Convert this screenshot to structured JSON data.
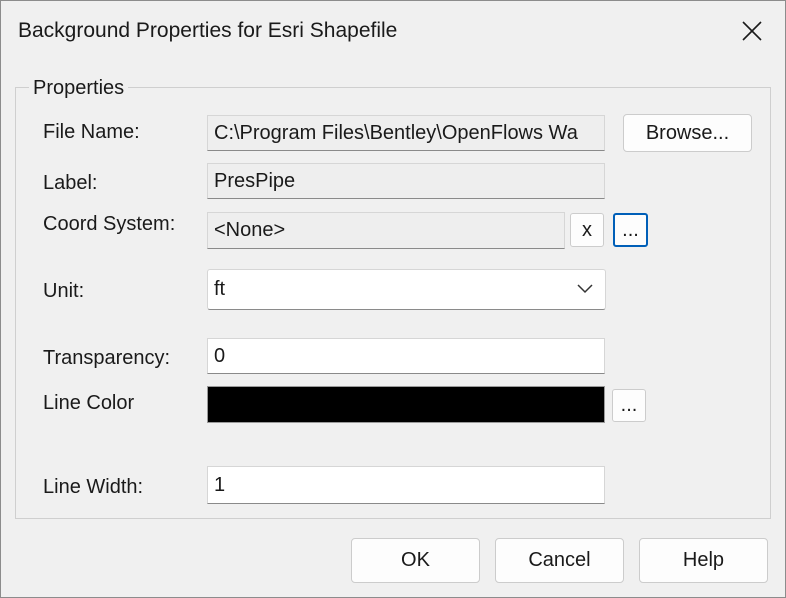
{
  "window": {
    "title": "Background Properties for Esri Shapefile"
  },
  "group": {
    "label": "Properties"
  },
  "fields": {
    "file_name": {
      "label": "File Name:",
      "value": "C:\\Program Files\\Bentley\\OpenFlows Wa",
      "browse_label": "Browse..."
    },
    "label": {
      "label": "Label:",
      "value": "PresPipe"
    },
    "coord_system": {
      "label": "Coord System:",
      "value": "<None>",
      "clear_label": "x",
      "more_label": "..."
    },
    "unit": {
      "label": "Unit:",
      "selected": "ft"
    },
    "transparency": {
      "label": "Transparency:",
      "value": "0"
    },
    "line_color": {
      "label": "Line Color",
      "color": "#000000",
      "more_label": "..."
    },
    "line_width": {
      "label": "Line Width:",
      "value": "1"
    }
  },
  "buttons": {
    "ok": "OK",
    "cancel": "Cancel",
    "help": "Help"
  },
  "colors": {
    "focus_border": "#005fb8",
    "dialog_background": "#f0f0f0"
  },
  "icons": {
    "close": "close-icon",
    "dropdown": "chevron-down-icon"
  }
}
